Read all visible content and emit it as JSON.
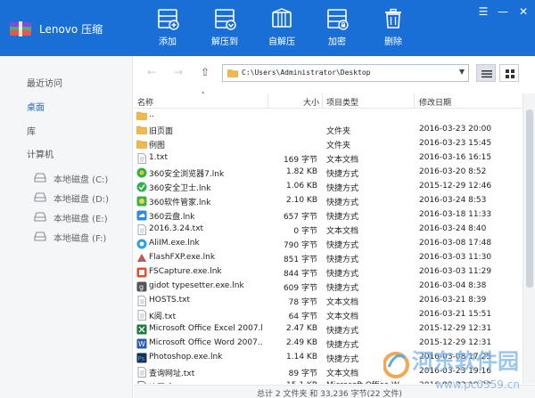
{
  "app": {
    "title": "Lenovo 压缩"
  },
  "toolbar": [
    {
      "id": "add",
      "label": "添加",
      "icon": "archive-add-icon"
    },
    {
      "id": "extract-to",
      "label": "解压到",
      "icon": "archive-extract-to-icon"
    },
    {
      "id": "auto-extract",
      "label": "自解压",
      "icon": "self-extract-icon"
    },
    {
      "id": "encrypt",
      "label": "加密",
      "icon": "lock-icon"
    },
    {
      "id": "delete",
      "label": "删除",
      "icon": "trash-icon"
    }
  ],
  "window_controls": {
    "menu": "☰",
    "minimize": "—",
    "close": "✕"
  },
  "sidebar": {
    "recent": "最近访问",
    "desktop": "桌面",
    "library": "库",
    "computer": "计算机",
    "drives": [
      "本地磁盘 (C:)",
      "本地磁盘 (D:)",
      "本地磁盘 (E:)",
      "本地磁盘 (F:)"
    ],
    "active": "desktop"
  },
  "address": {
    "path": "C:\\Users\\Administrator\\Desktop"
  },
  "columns": {
    "name": "名称",
    "size": "大小",
    "type": "项目类型",
    "date": "修改日期"
  },
  "files": [
    {
      "name": "..",
      "size": "",
      "type": "",
      "date": "",
      "icon": "folder-icon"
    },
    {
      "name": "旧页面",
      "size": "",
      "type": "文件夹",
      "date": "2016-03-23 20:00",
      "icon": "folder-icon"
    },
    {
      "name": "例图",
      "size": "",
      "type": "文件夹",
      "date": "2016-03-23 15:45",
      "icon": "folder-icon"
    },
    {
      "name": "1.txt",
      "size": "169 字节",
      "type": "文本文档",
      "date": "2016-03-16 16:15",
      "icon": "text-file-icon"
    },
    {
      "name": "360安全浏览器7.lnk",
      "size": "1.82 KB",
      "type": "快捷方式",
      "date": "2016-03-20 8:52",
      "icon": "360-browser-icon"
    },
    {
      "name": "360安全卫士.lnk",
      "size": "1.06 KB",
      "type": "快捷方式",
      "date": "2015-12-29 12:46",
      "icon": "360-safe-icon"
    },
    {
      "name": "360软件管家.lnk",
      "size": "2.10 KB",
      "type": "快捷方式",
      "date": "2016-03-24 8:53",
      "icon": "360-software-icon"
    },
    {
      "name": "360云盘.lnk",
      "size": "657 字节",
      "type": "快捷方式",
      "date": "2016-03-18 11:33",
      "icon": "360-cloud-icon"
    },
    {
      "name": "2016.3.24.txt",
      "size": "0 字节",
      "type": "文本文档",
      "date": "2016-03-24 8:40",
      "icon": "text-file-icon"
    },
    {
      "name": "AliIM.exe.lnk",
      "size": "790 字节",
      "type": "快捷方式",
      "date": "2016-03-08 17:48",
      "icon": "aliim-icon"
    },
    {
      "name": "FlashFXP.exe.lnk",
      "size": "851 字节",
      "type": "快捷方式",
      "date": "2016-03-03 11:30",
      "icon": "flashfxp-icon"
    },
    {
      "name": "FSCapture.exe.lnk",
      "size": "844 字节",
      "type": "快捷方式",
      "date": "2016-03-03 11:29",
      "icon": "fscapture-icon"
    },
    {
      "name": "gidot typesetter.exe.lnk",
      "size": "609 字节",
      "type": "快捷方式",
      "date": "2016-03-04 8:38",
      "icon": "gidot-icon"
    },
    {
      "name": "HOSTS.txt",
      "size": "78 字节",
      "type": "文本文档",
      "date": "2016-03-21 8:39",
      "icon": "text-file-icon"
    },
    {
      "name": "K阅.txt",
      "size": "64 字节",
      "type": "文本文档",
      "date": "2016-03-21 15:51",
      "icon": "text-file-icon"
    },
    {
      "name": "Microsoft Office Excel 2007.l...",
      "size": "2.47 KB",
      "type": "快捷方式",
      "date": "2015-12-29 12:31",
      "icon": "excel-icon"
    },
    {
      "name": "Microsoft Office Word 2007...",
      "size": "2.49 KB",
      "type": "快捷方式",
      "date": "2015-12-29 12:31",
      "icon": "word-icon"
    },
    {
      "name": "Photoshop.exe.lnk",
      "size": "1.14 KB",
      "type": "快捷方式",
      "date": "2016-03-08 17:25",
      "icon": "photoshop-icon"
    },
    {
      "name": "查询网址.txt",
      "size": "89 字节",
      "type": "文本文档",
      "date": "2016-03-23 19:16",
      "icon": "text-file-icon"
    },
    {
      "name": "速写成.docx",
      "size": "15.1 KB",
      "type": "Microsoft Office W...",
      "date": "2016-03-23 19:33",
      "icon": "word-doc-icon"
    }
  ],
  "status": {
    "text": "总计 2 文件夹 和 33,236 字节(22 文件)"
  },
  "watermark": {
    "text": "河东软件园",
    "url": "www.pc0359.cn"
  },
  "colors": {
    "accent": "#1a6fd6",
    "folder": "#f2b84b",
    "sidebar_bg": "#f5f6f8"
  }
}
